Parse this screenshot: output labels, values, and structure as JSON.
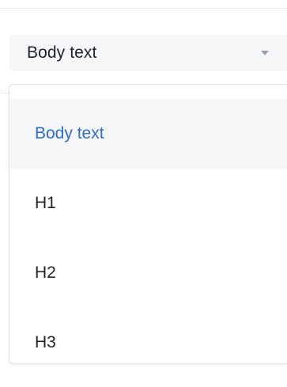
{
  "format_select": {
    "value": "Body text",
    "icon": "chevron-down-icon"
  },
  "menu": {
    "items": [
      {
        "label": "Body text",
        "selected": true
      },
      {
        "label": "H1",
        "selected": false
      },
      {
        "label": "H2",
        "selected": false
      },
      {
        "label": "H3",
        "selected": false
      }
    ]
  },
  "colors": {
    "accent": "#2f6cc4",
    "text": "#1f2329",
    "field_background": "#f4f6f8"
  }
}
